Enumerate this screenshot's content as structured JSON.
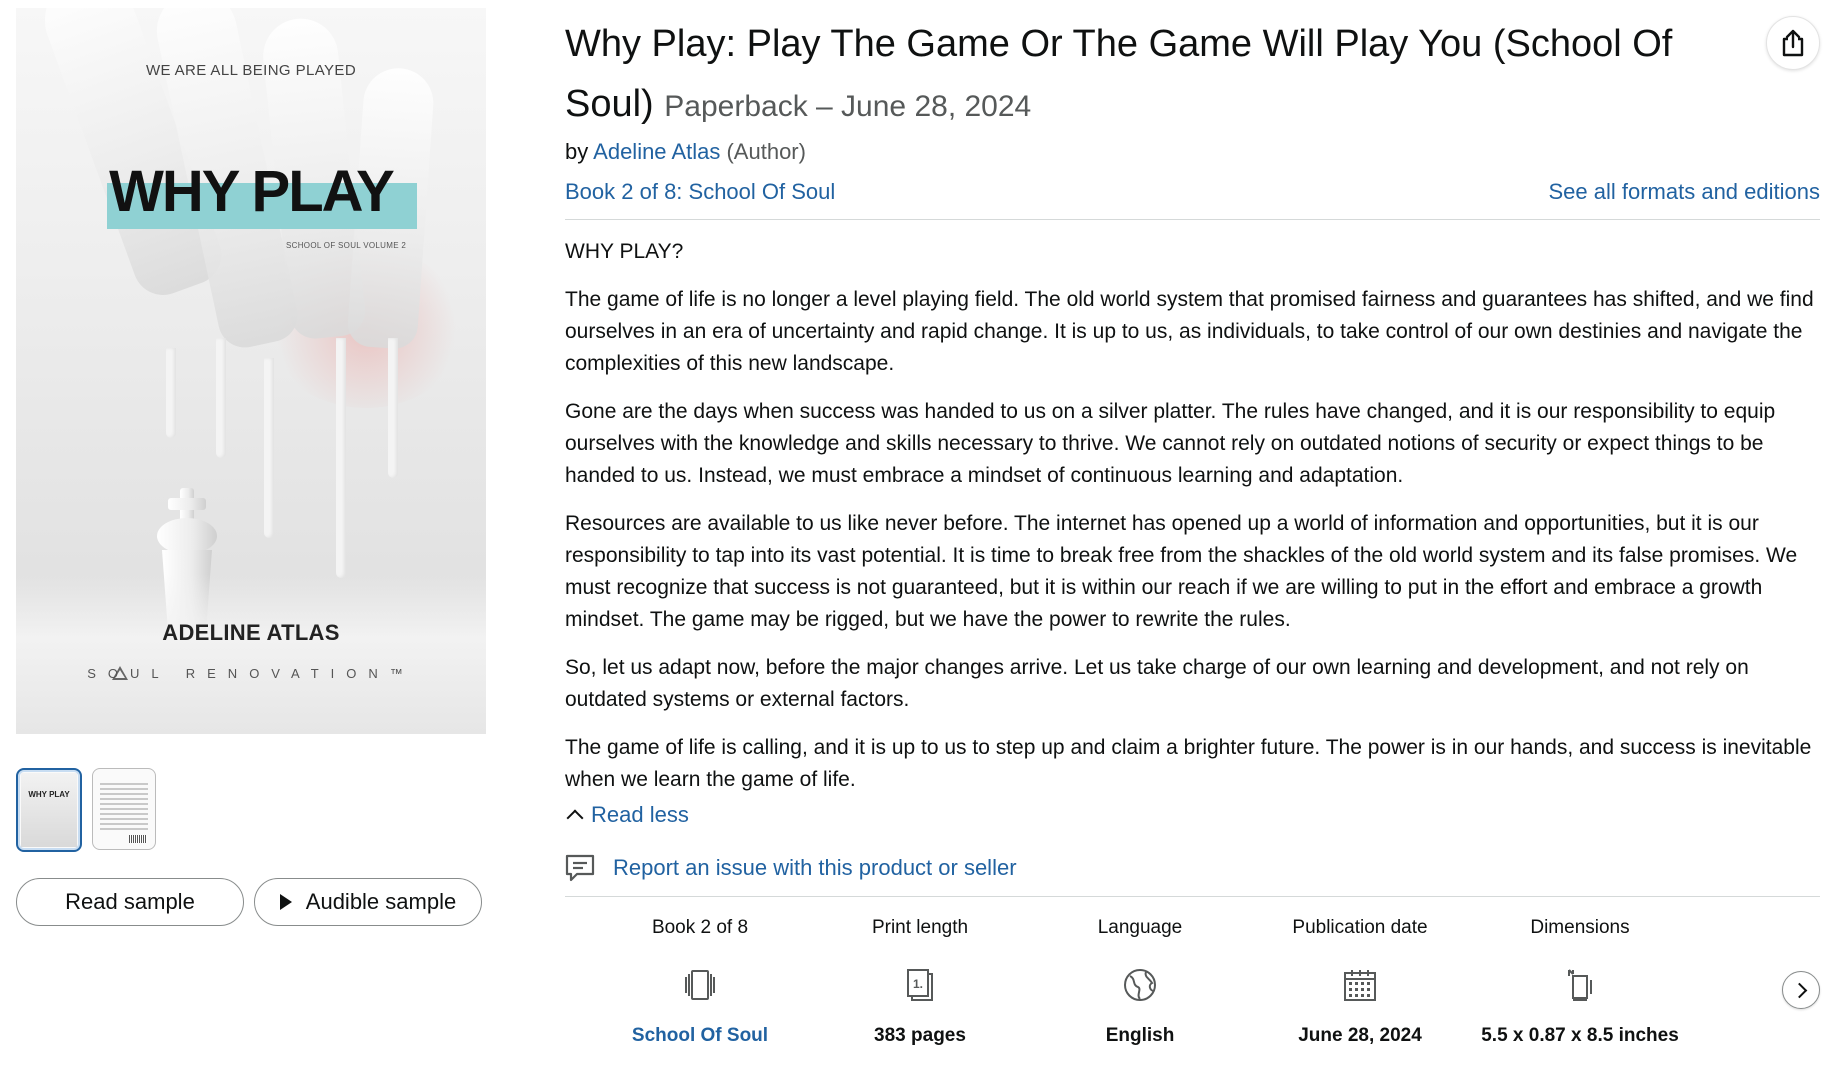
{
  "cover": {
    "tagline": "WE ARE ALL BEING PLAYED",
    "title": "WHY PLAY",
    "volume": "SCHOOL OF SOUL VOLUME 2",
    "author": "ADELINE ATLAS",
    "publisher": "SOUL RENOVATION™"
  },
  "thumbnails": [
    {
      "label": "WHY PLAY",
      "name": "front-cover"
    },
    {
      "label": "",
      "name": "back-cover"
    }
  ],
  "buttons": {
    "read_sample": "Read sample",
    "audible_sample": "Audible sample"
  },
  "product": {
    "title": "Why Play: Play The Game Or The Game Will Play You (School Of Soul)",
    "format": "Paperback – June 28, 2024",
    "by": "by",
    "author": "Adeline Atlas",
    "author_role": "(Author)",
    "series": "Book 2 of 8: School Of Soul",
    "formats_link": "See all formats and editions"
  },
  "description": {
    "heading": "WHY PLAY?",
    "paragraphs": [
      "The game of life is no longer a level playing field. The old world system that promised fairness and guarantees has shifted, and we find ourselves in an era of uncertainty and rapid change. It is up to us, as individuals, to take control of our own destinies and navigate the complexities of this new landscape.",
      "Gone are the days when success was handed to us on a silver platter. The rules have changed, and it is our responsibility to equip ourselves with the knowledge and skills necessary to thrive. We cannot rely on outdated notions of security or expect things to be handed to us. Instead, we must embrace a mindset of continuous learning and adaptation.",
      "Resources are available to us like never before. The internet has opened up a world of information and opportunities, but it is our responsibility to tap into its vast potential. It is time to break free from the shackles of the old world system and its false promises. We must recognize that success is not guaranteed, but it is within our reach if we are willing to put in the effort and embrace a growth mindset. The game may be rigged, but we have the power to rewrite the rules.",
      "So, let us adapt now, before the major changes arrive. Let us take charge of our own learning and development, and not rely on outdated systems or external factors.",
      "The game of life is calling, and it is up to us to step up and claim a brighter future. The power is in our hands, and success is inevitable when we learn the game of life."
    ],
    "read_less": "Read less"
  },
  "report_link": "Report an issue with this product or seller",
  "details": [
    {
      "label": "Book 2 of 8",
      "icon": "series-icon",
      "value": "School Of Soul",
      "is_link": true
    },
    {
      "label": "Print length",
      "icon": "pages-icon",
      "value": "383 pages",
      "is_link": false
    },
    {
      "label": "Language",
      "icon": "globe-icon",
      "value": "English",
      "is_link": false
    },
    {
      "label": "Publication date",
      "icon": "calendar-icon",
      "value": "June 28, 2024",
      "is_link": false
    },
    {
      "label": "Dimensions",
      "icon": "dimensions-icon",
      "value": "5.5 x 0.87 x 8.5 inches",
      "is_link": false
    }
  ],
  "colors": {
    "link": "#2162a1",
    "text": "#0f1111",
    "muted": "#565959",
    "cover_accent": "#8fd1d3"
  }
}
